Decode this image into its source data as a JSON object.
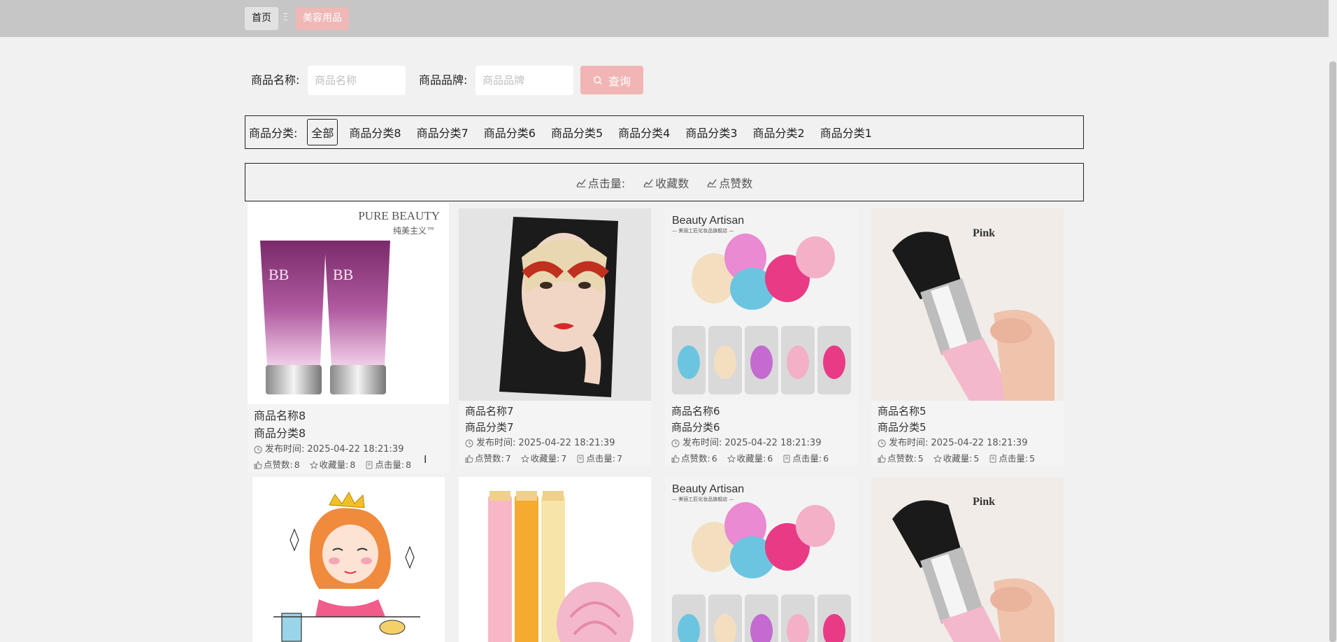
{
  "breadcrumb": {
    "home": "首页",
    "separator": "Ξ",
    "current": "美容用品"
  },
  "search": {
    "name_label": "商品名称:",
    "name_placeholder": "商品名称",
    "brand_label": "商品品牌:",
    "brand_placeholder": "商品品牌",
    "button_label": "查询"
  },
  "categories": {
    "label": "商品分类:",
    "items": [
      "全部",
      "商品分类8",
      "商品分类7",
      "商品分类6",
      "商品分类5",
      "商品分类4",
      "商品分类3",
      "商品分类2",
      "商品分类1"
    ]
  },
  "sort": {
    "items": [
      "点击量:",
      "收藏数",
      "点赞数"
    ]
  },
  "cards": [
    {
      "name": "商品名称8",
      "category": "商品分类8",
      "time_label": "发布时间:",
      "time": "2025-04-22 18:21:39",
      "like_label": "点赞数:",
      "like": "8",
      "fav_label": "收藏量:",
      "fav": "8",
      "click_label": "点击量:",
      "click": "8",
      "brand_text": "PURE BEAUTY",
      "brand_sub": "纯美主义™"
    },
    {
      "name": "商品名称7",
      "category": "商品分类7",
      "time_label": "发布时间:",
      "time": "2025-04-22 18:21:39",
      "like_label": "点赞数:",
      "like": "7",
      "fav_label": "收藏量:",
      "fav": "7",
      "click_label": "点击量:",
      "click": "7"
    },
    {
      "name": "商品名称6",
      "category": "商品分类6",
      "time_label": "发布时间:",
      "time": "2025-04-22 18:21:39",
      "like_label": "点赞数:",
      "like": "6",
      "fav_label": "收藏量:",
      "fav": "6",
      "click_label": "点击量:",
      "click": "6",
      "brand_text": "Beauty Artisan",
      "brand_sub": "— 美丽工匠化妆品旗舰店 —"
    },
    {
      "name": "商品名称5",
      "category": "商品分类5",
      "time_label": "发布时间:",
      "time": "2025-04-22 18:21:39",
      "like_label": "点赞数:",
      "like": "5",
      "fav_label": "收藏量:",
      "fav": "5",
      "click_label": "点击量:",
      "click": "5",
      "brand_text": "Pink"
    }
  ],
  "row2": [
    {},
    {},
    {
      "brand_text": "Beauty Artisan",
      "brand_sub": "— 美丽工匠化妆品旗舰店 —"
    },
    {
      "brand_text": "Pink"
    }
  ],
  "colors": {
    "topbar": "#c6c6c6",
    "accent": "#f1b5b5",
    "background": "#f1f1f1"
  }
}
